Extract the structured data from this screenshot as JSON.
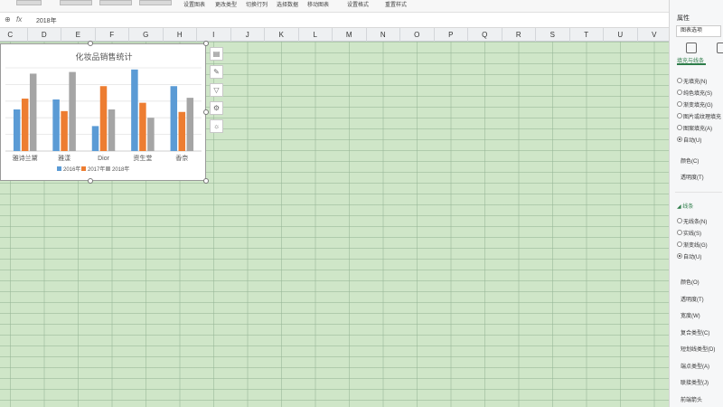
{
  "ribbon": {
    "items": [
      "设置图表",
      "更改类型",
      "切换行列",
      "选择数据",
      "移动图表",
      "设置格式",
      "重置样式"
    ]
  },
  "formula_bar": {
    "zoom_icon": "zoom-icon",
    "fx_label": "fx",
    "value": "2018年"
  },
  "columns": [
    "C",
    "D",
    "E",
    "F",
    "G",
    "H",
    "I",
    "J",
    "K",
    "L",
    "M",
    "N",
    "O",
    "P",
    "Q",
    "R",
    "S",
    "T",
    "U",
    "V"
  ],
  "chart_data": {
    "type": "bar",
    "title": "化妆品销售统计",
    "categories": [
      "雅诗兰黛",
      "雅漾",
      "Dior",
      "资生堂",
      "香奈"
    ],
    "series": [
      {
        "name": "2016年",
        "color": "#5b9bd5",
        "values": [
          5,
          6.2,
          3,
          9.8,
          7.8
        ]
      },
      {
        "name": "2017年",
        "color": "#ed7d31",
        "values": [
          6.3,
          4.8,
          7.8,
          5.8,
          4.7
        ]
      },
      {
        "name": "2018年",
        "color": "#a5a5a5",
        "values": [
          9.3,
          9.5,
          5,
          4,
          6.4
        ]
      }
    ],
    "ylim": [
      0,
      10
    ],
    "grid": true,
    "legend": "bottom"
  },
  "chart_tools": [
    "layers-icon",
    "pen-icon",
    "filter-icon",
    "gear-icon",
    "bulb-icon"
  ],
  "panel": {
    "title": "属性",
    "select": "图表选项",
    "tab_label": "填充与线条",
    "fill_options": [
      "无填充(N)",
      "纯色填充(S)",
      "渐变填充(G)",
      "图片或纹理填充",
      "图案填充(A)",
      "自动(U)"
    ],
    "fill_selected": 5,
    "fill_props": [
      "颜色(C)",
      "透明度(T)"
    ],
    "line_section": "线条",
    "line_options": [
      "无线条(N)",
      "实线(S)",
      "渐变线(G)",
      "自动(U)"
    ],
    "line_selected": 3,
    "line_props": [
      "颜色(O)",
      "透明度(T)",
      "宽度(W)",
      "复合类型(C)",
      "短划线类型(D)",
      "端点类型(A)",
      "联接类型(J)",
      "前端箭头"
    ]
  }
}
